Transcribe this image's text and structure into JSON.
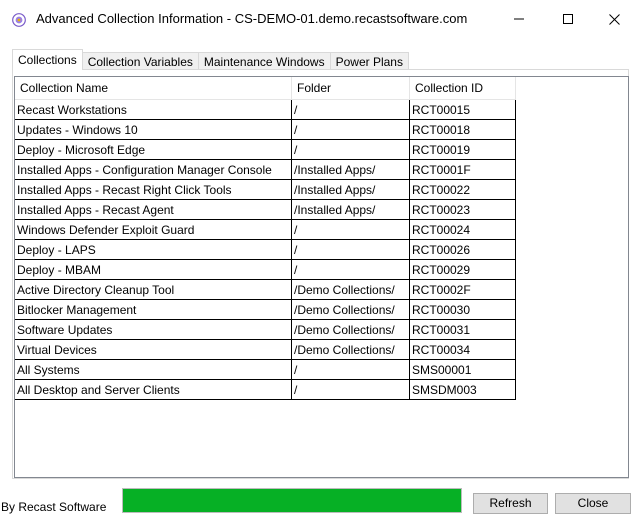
{
  "window": {
    "title": "Advanced Collection Information - CS-DEMO-01.demo.recastsoftware.com",
    "app_icon": "recast-logo-icon",
    "controls": [
      "minimize-icon",
      "maximize-icon",
      "close-icon"
    ]
  },
  "tabs": [
    {
      "label": "Collections",
      "active": true
    },
    {
      "label": "Collection Variables",
      "active": false
    },
    {
      "label": "Maintenance Windows",
      "active": false
    },
    {
      "label": "Power Plans",
      "active": false
    }
  ],
  "grid": {
    "columns": [
      "Collection Name",
      "Folder",
      "Collection ID"
    ],
    "rows": [
      [
        "Recast Workstations",
        "/",
        "RCT00015"
      ],
      [
        "Updates - Windows 10",
        "/",
        "RCT00018"
      ],
      [
        "Deploy - Microsoft Edge",
        "/",
        "RCT00019"
      ],
      [
        "Installed Apps - Configuration Manager Console",
        "/Installed Apps/",
        "RCT0001F"
      ],
      [
        "Installed Apps - Recast Right Click Tools",
        "/Installed Apps/",
        "RCT00022"
      ],
      [
        "Installed Apps - Recast Agent",
        "/Installed Apps/",
        "RCT00023"
      ],
      [
        "Windows Defender Exploit Guard",
        "/",
        "RCT00024"
      ],
      [
        "Deploy - LAPS",
        "/",
        "RCT00026"
      ],
      [
        "Deploy - MBAM",
        "/",
        "RCT00029"
      ],
      [
        "Active Directory Cleanup Tool",
        "/Demo Collections/",
        "RCT0002F"
      ],
      [
        "Bitlocker Management",
        "/Demo Collections/",
        "RCT00030"
      ],
      [
        "Software Updates",
        "/Demo Collections/",
        "RCT00031"
      ],
      [
        "Virtual Devices",
        "/Demo Collections/",
        "RCT00034"
      ],
      [
        "All Systems",
        "/",
        "SMS00001"
      ],
      [
        "All Desktop and Server Clients",
        "/",
        "SMSDM003"
      ]
    ]
  },
  "footer": {
    "label": "By Recast Software",
    "progress_percent": 100,
    "progress_color": "#06b025",
    "refresh_label": "Refresh",
    "close_label": "Close"
  }
}
